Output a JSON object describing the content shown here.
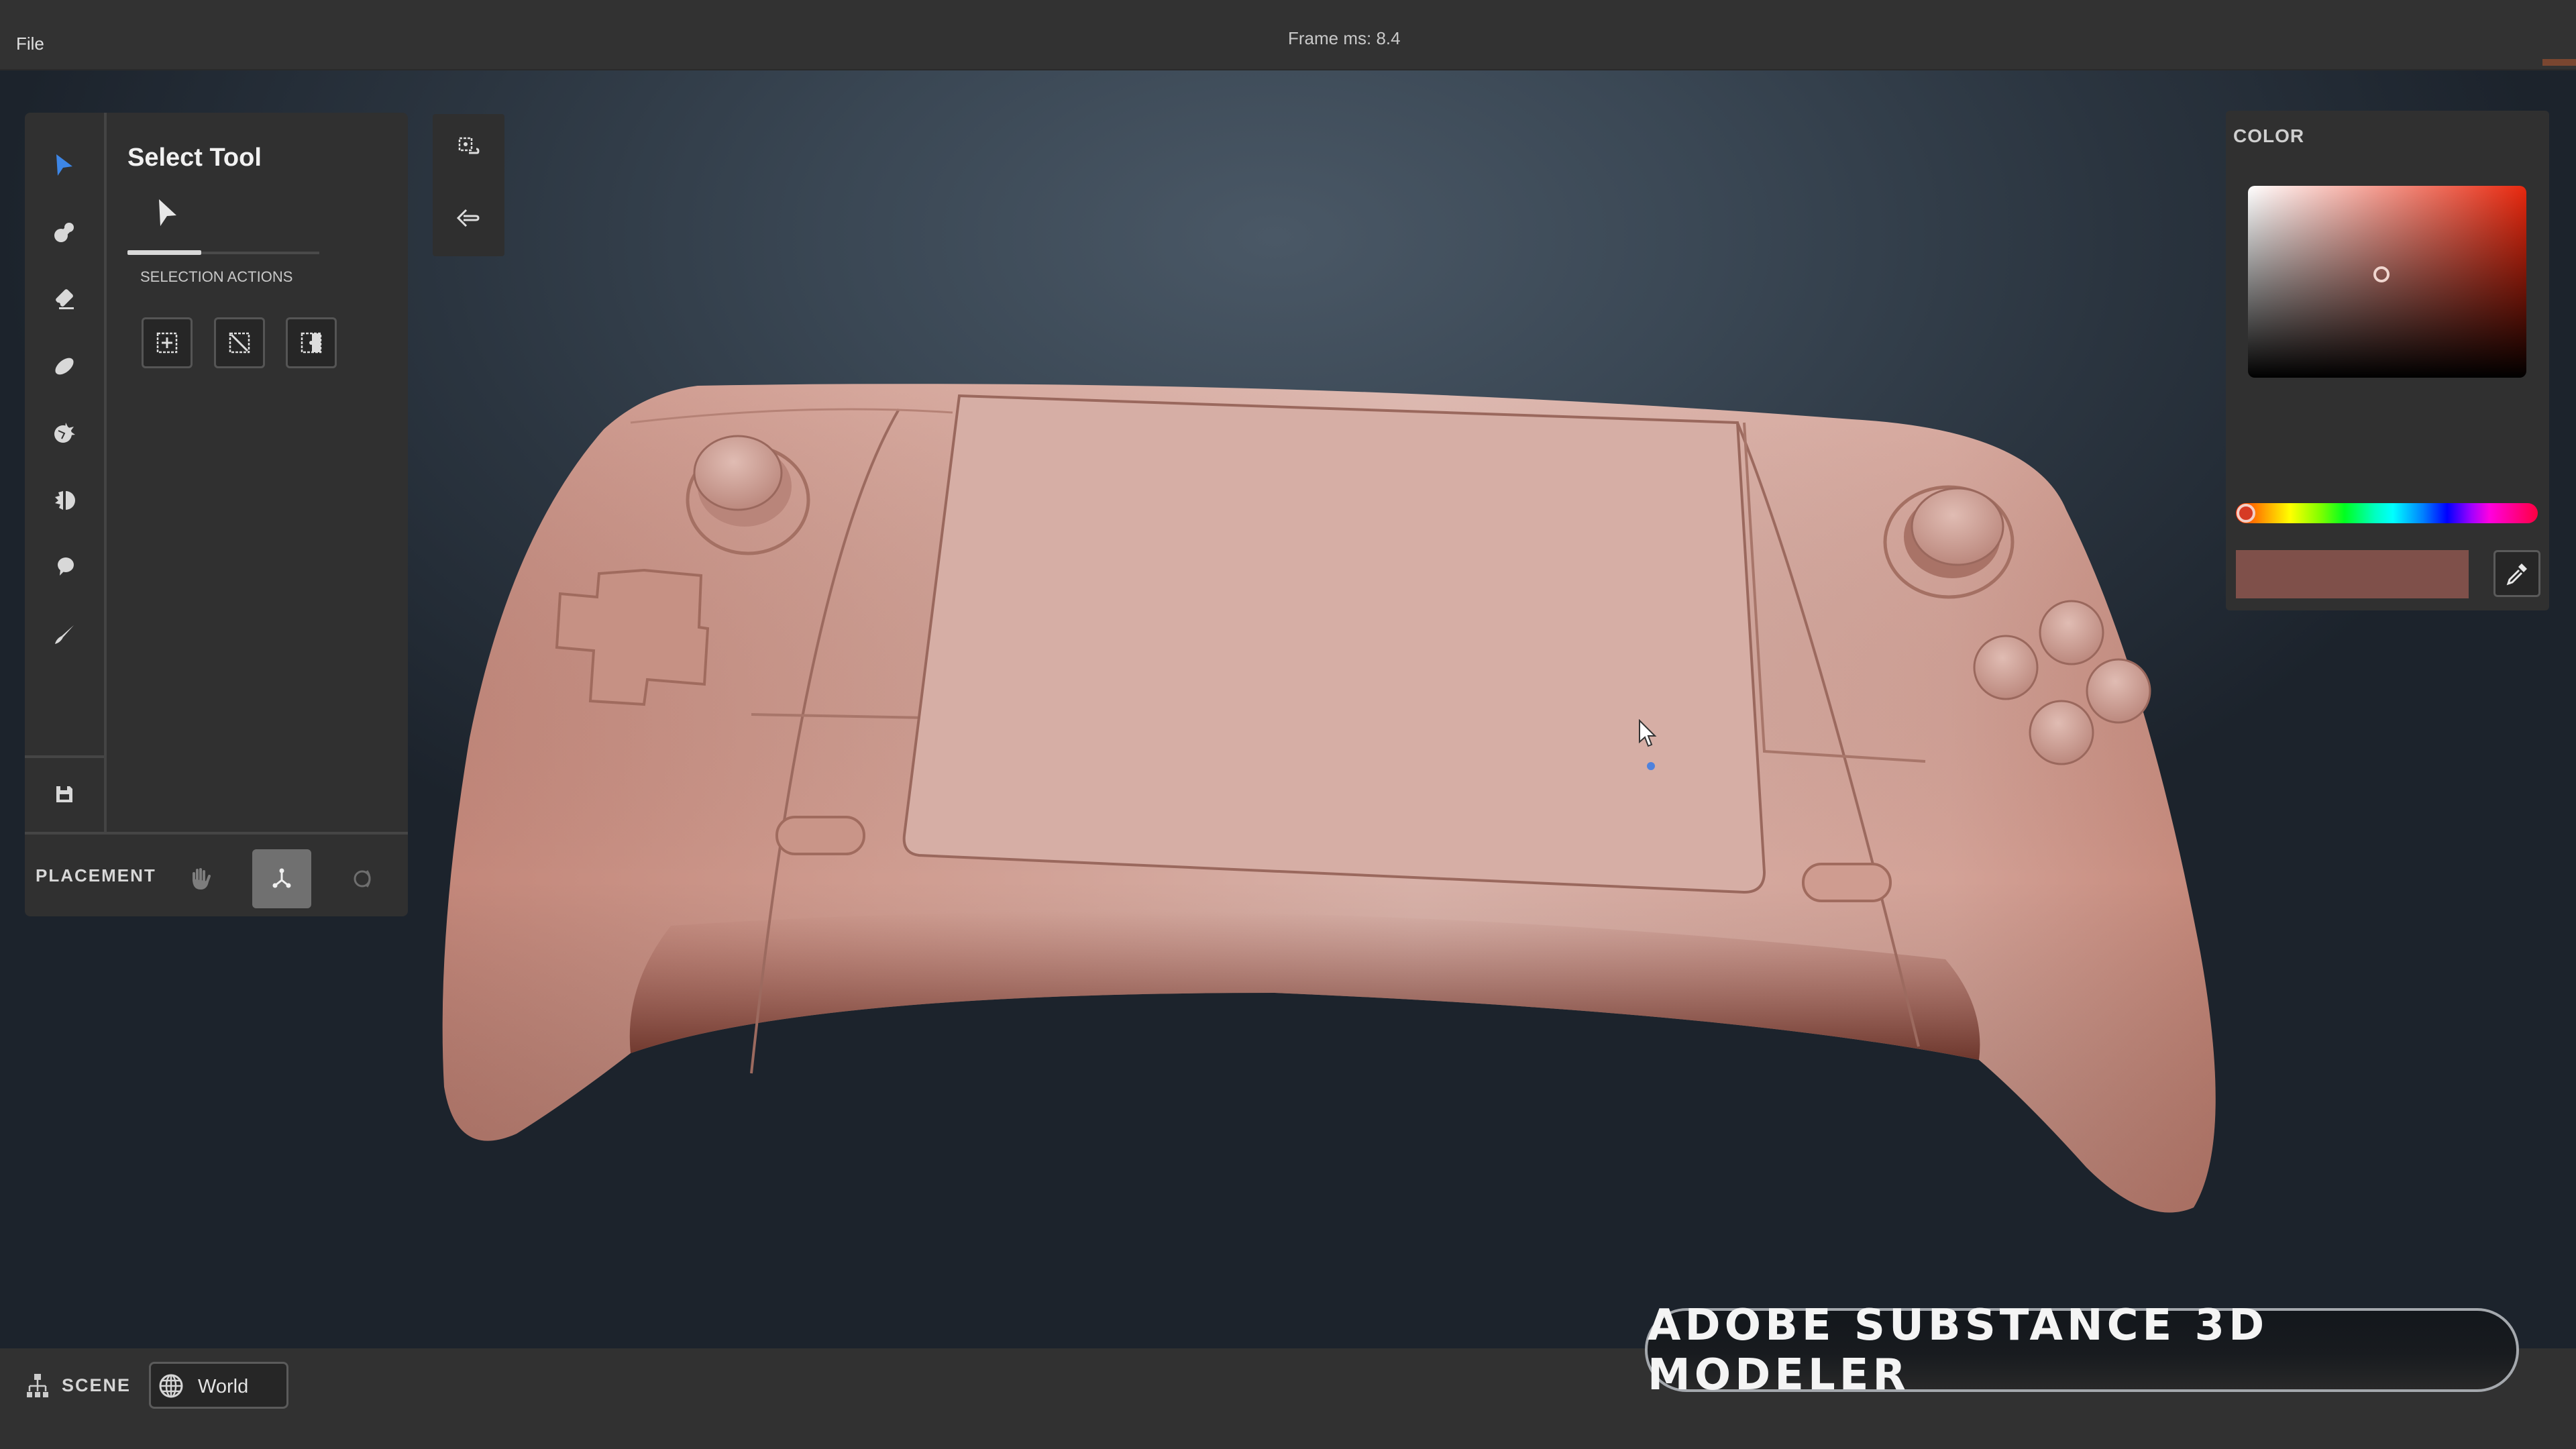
{
  "app": {
    "menu": {
      "file_label": "File"
    },
    "status": {
      "frame_ms_text": "Frame ms: 8.4"
    }
  },
  "toolbar": {
    "tools": [
      {
        "name": "select",
        "icon": "select-arrow-icon",
        "active": true
      },
      {
        "name": "clay",
        "icon": "clay-blob-icon",
        "active": false
      },
      {
        "name": "erase",
        "icon": "eraser-icon",
        "active": false
      },
      {
        "name": "smooth",
        "icon": "smooth-pill-icon",
        "active": false
      },
      {
        "name": "crease",
        "icon": "crease-burst-icon",
        "active": false
      },
      {
        "name": "flatten",
        "icon": "flatten-half-icon",
        "active": false
      },
      {
        "name": "inflate",
        "icon": "balloon-icon",
        "active": false
      },
      {
        "name": "paint",
        "icon": "paint-brush-icon",
        "active": false
      },
      {
        "name": "save",
        "icon": "save-icon",
        "active": false
      }
    ],
    "accent_color": "#3d86e6"
  },
  "tool_panel": {
    "title": "Select Tool",
    "tab_icon": "select-arrow-icon",
    "section_label": "SELECTION ACTIONS",
    "actions": [
      {
        "name": "select-all",
        "icon": "select-all-icon"
      },
      {
        "name": "deselect",
        "icon": "deselect-icon"
      },
      {
        "name": "invert-selection",
        "icon": "invert-selection-icon"
      }
    ]
  },
  "placement": {
    "label": "PLACEMENT",
    "modes": [
      {
        "name": "hand",
        "icon": "hand-icon",
        "active": false
      },
      {
        "name": "gizmo",
        "icon": "gizmo-axes-icon",
        "active": true
      },
      {
        "name": "orbit",
        "icon": "orbit-ring-icon",
        "active": false
      }
    ]
  },
  "mini_toolbar": [
    {
      "name": "frame-selection",
      "icon": "frame-selection-icon"
    },
    {
      "name": "undo-view",
      "icon": "back-arrow-icon"
    }
  ],
  "color_panel": {
    "title": "COLOR",
    "hue_color": "#e8280e",
    "saturation": 0.48,
    "brightness": 0.54,
    "hue_position": 0.0,
    "current_color": "#7f504a"
  },
  "scene_bar": {
    "scene_label": "SCENE",
    "space_value": "World"
  },
  "banner": {
    "text": "ADOBE SUBSTANCE 3D MODELER"
  }
}
